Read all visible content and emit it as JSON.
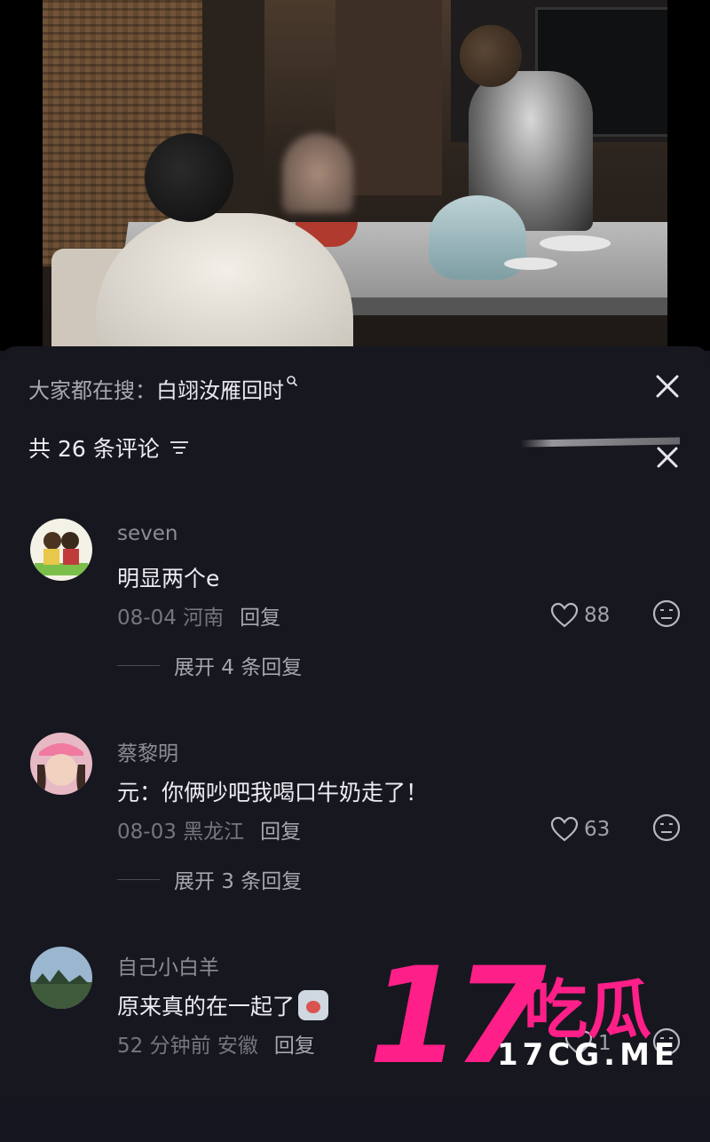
{
  "hot_search": {
    "prefix": "大家都在搜：",
    "keyword": "白翊汝雁回时"
  },
  "comment_count_label": "共 26 条评论",
  "comments": [
    {
      "username": "seven",
      "text": "明显两个e",
      "date": "08-04",
      "location": "河南",
      "reply_label": "回复",
      "likes": "88",
      "expand_label": "展开 4 条回复"
    },
    {
      "username": "蔡黎明",
      "text": "元：你俩吵吧我喝口牛奶走了！",
      "date": "08-03",
      "location": "黑龙江",
      "reply_label": "回复",
      "likes": "63",
      "expand_label": "展开 3 条回复"
    },
    {
      "username": "自己小白羊",
      "text": "原来真的在一起了",
      "date": "52 分钟前",
      "location": "安徽",
      "reply_label": "回复",
      "likes": "1"
    }
  ],
  "watermark": {
    "number": "17",
    "chinese": "吃瓜",
    "url": "17CG.ME"
  },
  "colors": {
    "background": "#17171f",
    "watermark": "#ff1f88"
  }
}
